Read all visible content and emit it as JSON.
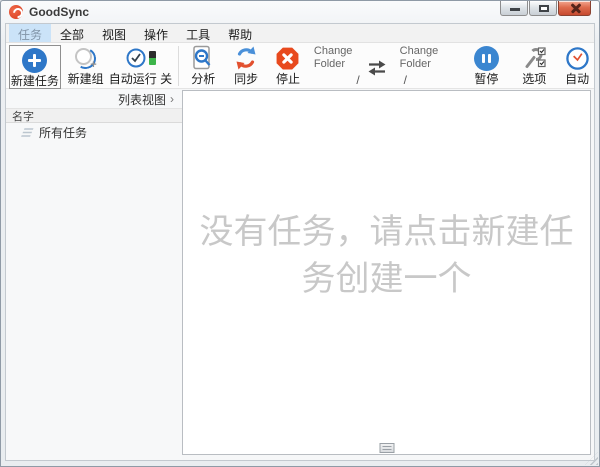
{
  "window": {
    "title": "GoodSync"
  },
  "menu": {
    "items": [
      {
        "label": "任务",
        "selected": true
      },
      {
        "label": "全部",
        "selected": false
      },
      {
        "label": "视图",
        "selected": false
      },
      {
        "label": "操作",
        "selected": false
      },
      {
        "label": "工具",
        "selected": false
      },
      {
        "label": "帮助",
        "selected": false
      }
    ]
  },
  "toolbar": {
    "new_task_label": "新建任务",
    "new_group_label": "新建组",
    "autorun_label": "自动运行 关",
    "analyze_label": "分析",
    "sync_label": "同步",
    "stop_label": "停止",
    "left_folder": {
      "label": "Change Folder",
      "path": "/"
    },
    "right_folder": {
      "label": "Change Folder",
      "path": "/"
    },
    "pause_label": "暂停",
    "options_label": "选项",
    "auto_label": "自动"
  },
  "sidebar": {
    "view_switcher_label": "列表视图",
    "view_switcher_chevron": "›",
    "column_header": "名字",
    "items": [
      {
        "label": "所有任务"
      }
    ]
  },
  "main": {
    "empty_message_line1": "没有任务，请点击新建任",
    "empty_message_line2": "务创建一个"
  },
  "colors": {
    "accent_blue": "#2e77c8",
    "pause_blue": "#3b86d0",
    "stop_red": "#e8491d",
    "sync_red": "#e2502f",
    "toggle_green": "#3db54a",
    "close_button_red": "#c64a2f",
    "menu_highlight": "#cbe3f8",
    "watermark_gray": "#c8c8c8"
  }
}
